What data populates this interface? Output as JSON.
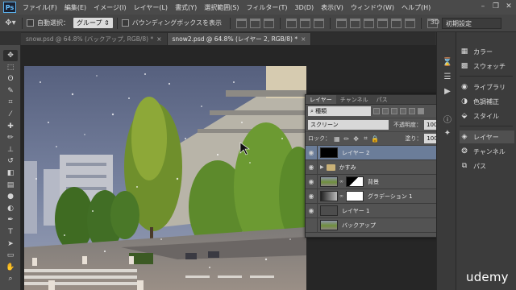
{
  "app": {
    "logo": "Ps"
  },
  "menu": [
    "ファイル(F)",
    "編集(E)",
    "イメージ(I)",
    "レイヤー(L)",
    "書式(Y)",
    "選択範囲(S)",
    "フィルター(T)",
    "3D(D)",
    "表示(V)",
    "ウィンドウ(W)",
    "ヘルプ(H)"
  ],
  "window_controls": {
    "minimize": "–",
    "restore": "❐",
    "close": "✕"
  },
  "options": {
    "auto_select_label": "自動選択：",
    "auto_select_value": "グループ",
    "bounding_box_label": "バウンディングボックスを表示",
    "mode_3d_label": "3D",
    "workspace": "初期設定"
  },
  "tabs": [
    {
      "label": "snow.psd @ 64.8% (バックアップ, RGB/8) *",
      "close": "×"
    },
    {
      "label": "snow2.psd @ 64.8% (レイヤー 2, RGB/8) *",
      "close": "×"
    }
  ],
  "tools": [
    {
      "name": "move-tool-icon",
      "glyph": "✥"
    },
    {
      "name": "marquee-tool-icon",
      "glyph": "⬚"
    },
    {
      "name": "lasso-tool-icon",
      "glyph": "ʘ"
    },
    {
      "name": "quick-select-tool-icon",
      "glyph": "✎"
    },
    {
      "name": "crop-tool-icon",
      "glyph": "⌗"
    },
    {
      "name": "eyedropper-tool-icon",
      "glyph": "⁄"
    },
    {
      "name": "healing-brush-tool-icon",
      "glyph": "✚"
    },
    {
      "name": "brush-tool-icon",
      "glyph": "✏"
    },
    {
      "name": "clone-stamp-tool-icon",
      "glyph": "⊥"
    },
    {
      "name": "history-brush-tool-icon",
      "glyph": "↺"
    },
    {
      "name": "eraser-tool-icon",
      "glyph": "◧"
    },
    {
      "name": "gradient-tool-icon",
      "glyph": "▤"
    },
    {
      "name": "blur-tool-icon",
      "glyph": "●"
    },
    {
      "name": "dodge-tool-icon",
      "glyph": "◐"
    },
    {
      "name": "pen-tool-icon",
      "glyph": "✒"
    },
    {
      "name": "type-tool-icon",
      "glyph": "T"
    },
    {
      "name": "path-select-tool-icon",
      "glyph": "➤"
    },
    {
      "name": "shape-tool-icon",
      "glyph": "▭"
    },
    {
      "name": "hand-tool-icon",
      "glyph": "✋"
    },
    {
      "name": "zoom-tool-icon",
      "glyph": "⌕"
    }
  ],
  "right_panel": {
    "items": [
      {
        "label": "カラー",
        "glyph": "▦"
      },
      {
        "label": "スウォッチ",
        "glyph": "▩"
      },
      {
        "label": "ライブラリ",
        "glyph": "◉"
      },
      {
        "label": "色調補正",
        "glyph": "◑"
      },
      {
        "label": "スタイル",
        "glyph": "⬙"
      },
      {
        "label": "レイヤー",
        "glyph": "◈"
      },
      {
        "label": "チャンネル",
        "glyph": "❂"
      },
      {
        "label": "パス",
        "glyph": "⧉"
      }
    ]
  },
  "layers_panel": {
    "tabs": [
      "レイヤー",
      "チャンネル",
      "パス"
    ],
    "menu_glyph": "≡",
    "filter_kind": "種類",
    "blend_mode": "スクリーン",
    "opacity_label": "不透明度：",
    "opacity_value": "100%",
    "lock_label": "ロック：",
    "fill_label": "塗り：",
    "fill_value": "100%",
    "layers": [
      {
        "name": "レイヤー 2",
        "visible": true,
        "selected": true,
        "thumb": "#000000"
      },
      {
        "name": "かすみ",
        "visible": true,
        "folder": true
      },
      {
        "name": "背景",
        "visible": true,
        "thumb": "photo",
        "mask": true
      },
      {
        "name": "グラデーション 1",
        "visible": true,
        "thumb": "gradient",
        "mask": true
      },
      {
        "name": "レイヤー 1",
        "visible": true,
        "thumb": "#4d4d4d"
      },
      {
        "name": "バックアップ",
        "visible": false,
        "thumb": "photo"
      }
    ]
  },
  "watermark": "udemy",
  "colors": {
    "selected_layer": "#6b7d99",
    "accent": "#5ab0ea"
  }
}
